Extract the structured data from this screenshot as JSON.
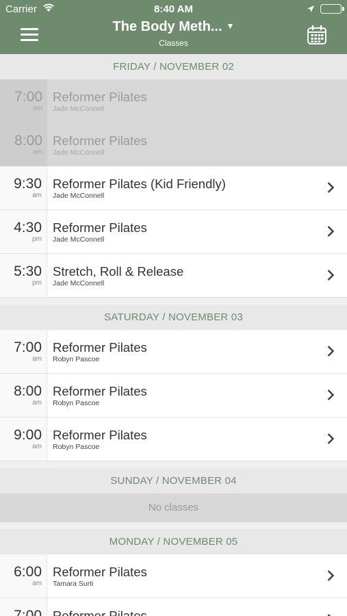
{
  "status_bar": {
    "carrier": "Carrier",
    "time": "8:40 AM"
  },
  "header": {
    "title": "The Body Meth...",
    "subtitle": "Classes"
  },
  "days": [
    {
      "label": "FRIDAY / NOVEMBER 02",
      "classes": [
        {
          "time": "7:00",
          "ampm": "am",
          "name": "Reformer Pilates",
          "instructor": "Jade McConnell",
          "past": true
        },
        {
          "time": "8:00",
          "ampm": "am",
          "name": "Reformer Pilates",
          "instructor": "Jade McConnell",
          "past": true
        },
        {
          "time": "9:30",
          "ampm": "am",
          "name": "Reformer Pilates (Kid Friendly)",
          "instructor": "Jade McConnell",
          "past": false
        },
        {
          "time": "4:30",
          "ampm": "pm",
          "name": "Reformer Pilates",
          "instructor": "Jade McConnell",
          "past": false
        },
        {
          "time": "5:30",
          "ampm": "pm",
          "name": "Stretch, Roll & Release",
          "instructor": "Jade McConnell",
          "past": false
        }
      ]
    },
    {
      "label": "SATURDAY / NOVEMBER 03",
      "classes": [
        {
          "time": "7:00",
          "ampm": "am",
          "name": "Reformer Pilates",
          "instructor": "Robyn Pascoe",
          "past": false
        },
        {
          "time": "8:00",
          "ampm": "am",
          "name": "Reformer Pilates",
          "instructor": "Robyn Pascoe",
          "past": false
        },
        {
          "time": "9:00",
          "ampm": "am",
          "name": "Reformer Pilates",
          "instructor": "Robyn Pascoe",
          "past": false
        }
      ]
    },
    {
      "label": "SUNDAY / NOVEMBER 04",
      "classes": [],
      "empty_text": "No classes"
    },
    {
      "label": "MONDAY / NOVEMBER 05",
      "classes": [
        {
          "time": "6:00",
          "ampm": "am",
          "name": "Reformer Pilates",
          "instructor": "Tamara Surti",
          "past": false
        },
        {
          "time": "7:00",
          "ampm": "",
          "name": "Reformer Pilates",
          "instructor": "",
          "past": false
        }
      ]
    }
  ]
}
